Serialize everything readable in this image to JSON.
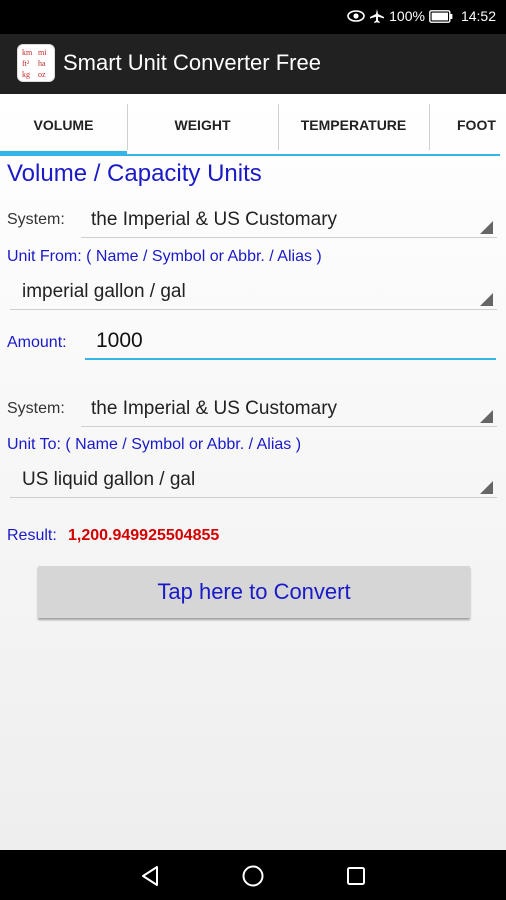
{
  "status_bar": {
    "battery": "100%",
    "time": "14:52",
    "icons": [
      "eye-icon",
      "airplane-icon",
      "battery-icon"
    ]
  },
  "app_bar": {
    "title": "Smart Unit Converter Free",
    "icon_letters": [
      "km",
      "mi",
      "ft²",
      "ha",
      "kg",
      "oz"
    ]
  },
  "tabs": [
    {
      "label": "VOLUME",
      "active": true
    },
    {
      "label": "WEIGHT",
      "active": false
    },
    {
      "label": "TEMPERATURE",
      "active": false
    },
    {
      "label": "FOOT",
      "active": false
    }
  ],
  "section_title": "Volume / Capacity Units",
  "from": {
    "system_label": "System:",
    "system_value": "the Imperial & US Customary",
    "unit_label": "Unit From: ( Name / Symbol or Abbr. / Alias )",
    "unit_value": "imperial gallon / gal"
  },
  "amount": {
    "label": "Amount:",
    "value": "1000"
  },
  "to": {
    "system_label": "System:",
    "system_value": "the Imperial & US Customary",
    "unit_label": "Unit To: ( Name / Symbol or Abbr. / Alias )",
    "unit_value": "US liquid gallon / gal"
  },
  "result": {
    "label": "Result:",
    "value": "1,200.949925504855"
  },
  "convert_button": "Tap here to Convert",
  "colors": {
    "accent": "#33b5e5",
    "label_blue": "#1a1ac8",
    "result_red": "#d50000",
    "action_bar": "#212121"
  }
}
